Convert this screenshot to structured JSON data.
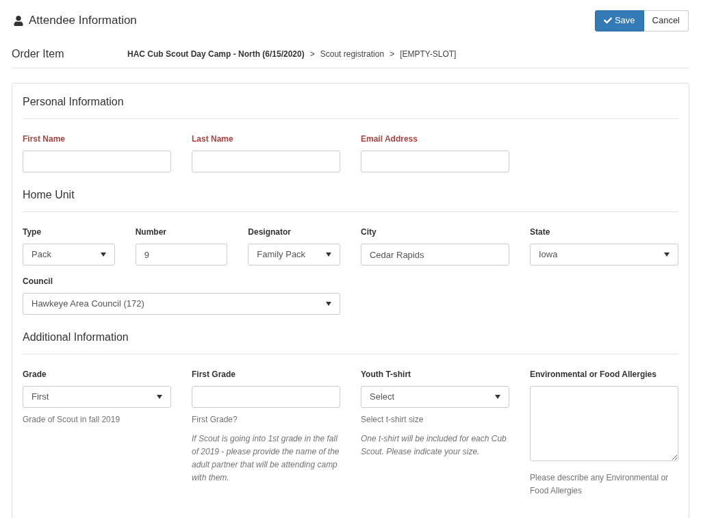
{
  "header": {
    "title": "Attendee Information",
    "buttons": [
      {
        "label": "Save",
        "kind": "primary"
      },
      {
        "label": "Cancel",
        "kind": "default"
      }
    ]
  },
  "order_item": {
    "label": "Order Item",
    "path": [
      "HAC Cub Scout Day Camp - North (6/15/2020)",
      "Scout registration",
      "[EMPTY-SLOT]"
    ],
    "separator": ">"
  },
  "sections": [
    {
      "title": "Personal Information",
      "fields": [
        {
          "label": "First Name",
          "kind": "text",
          "required": true
        },
        {
          "label": "Last Name",
          "kind": "text",
          "required": true
        },
        {
          "label": "Email Address",
          "kind": "text",
          "required": true
        }
      ]
    },
    {
      "title": "Home Unit",
      "fields": [
        {
          "label": "Type",
          "kind": "select",
          "required": false,
          "value": "Pack"
        },
        {
          "label": "Number",
          "kind": "text",
          "required": false,
          "value": "9"
        },
        {
          "label": "Designator",
          "kind": "select",
          "required": false,
          "value": "Family Pack"
        },
        {
          "label": "City",
          "kind": "text",
          "required": false,
          "value": "Cedar Rapids"
        },
        {
          "label": "State",
          "kind": "select",
          "required": false,
          "value": "Iowa"
        },
        {
          "label": "Council",
          "kind": "select",
          "required": false,
          "value": "Hawkeye Area Council (172)"
        }
      ]
    },
    {
      "title": "Additional Information",
      "fields": [
        {
          "label": "Grade",
          "kind": "select",
          "required": false,
          "value": "First",
          "help": "Grade of Scout in fall 2019"
        },
        {
          "label": "First Grade",
          "kind": "text",
          "required": false,
          "help": "First Grade?",
          "note": "If Scout is going into 1st grade in the fall of 2019 - please provide the name of the adult partner that will be attending camp with them."
        },
        {
          "label": "Youth T-shirt",
          "kind": "select",
          "required": false,
          "value": "Select",
          "help": "Select t-shirt size",
          "note": "One t-shirt will be included for each Cub Scout. Please indicate your size."
        },
        {
          "label": "Environmental or Food Allergies",
          "kind": "textarea",
          "required": false,
          "help": "Please describe any Environmental or Food Allergies"
        }
      ]
    }
  ]
}
